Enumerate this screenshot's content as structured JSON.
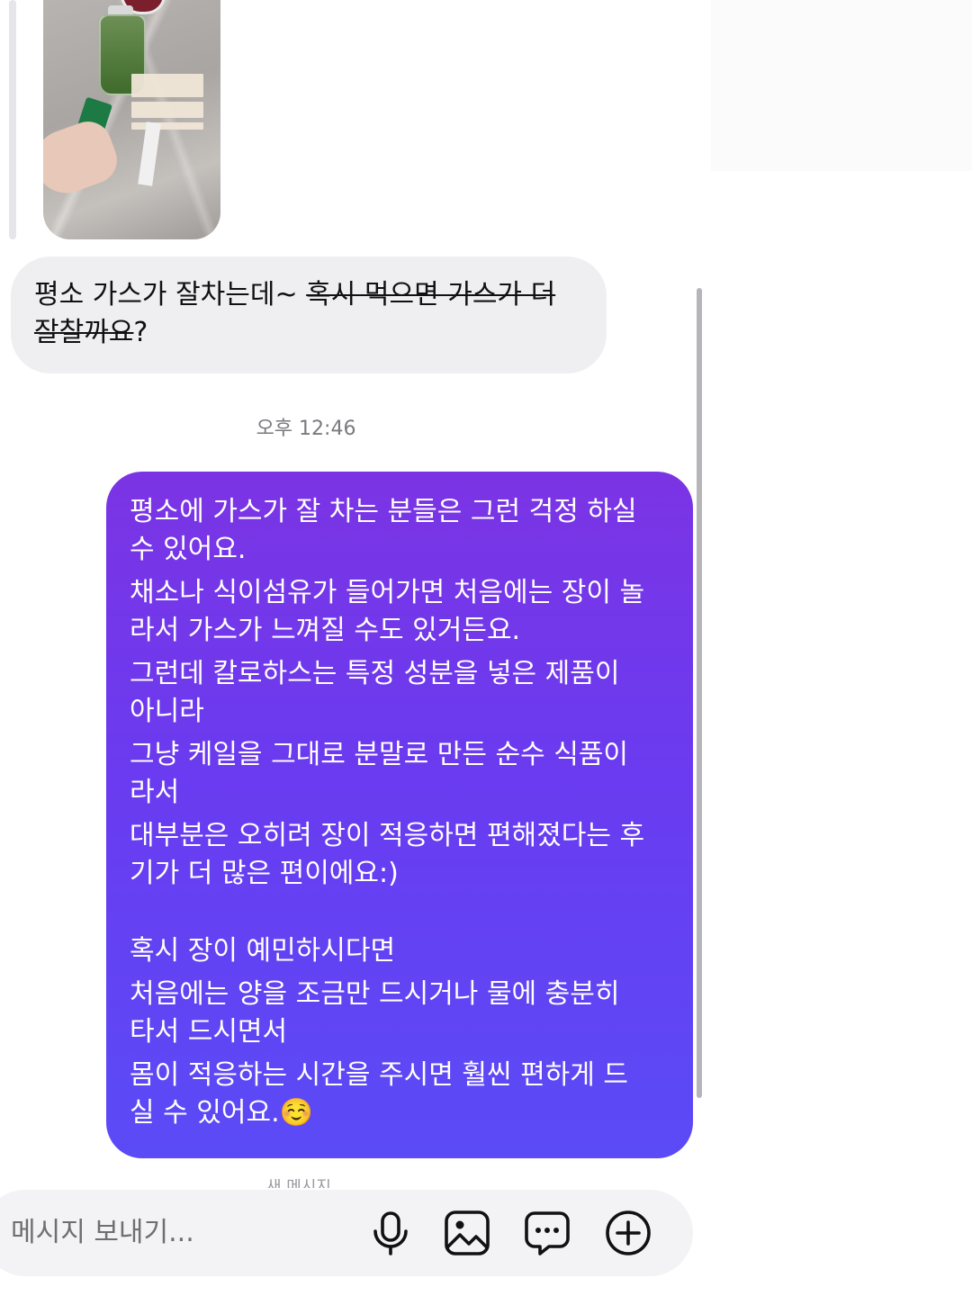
{
  "conversation": {
    "received_message": {
      "plain": "평소 가스가 잘차는데~",
      "strikethrough_line1": "혹시 먹으면 가스가 더",
      "strikethrough_line2": "잘찰까요",
      "ending": "?"
    },
    "timestamp": "오후 12:46",
    "sent_message": {
      "lines": [
        "평소에 가스가 잘 차는 분들은 그런 걱정 하실",
        "수 있어요.",
        "채소나 식이섬유가 들어가면 처음에는 장이 놀",
        "라서 가스가 느껴질 수도 있거든요.",
        "그런데 칼로하스는 특정 성분을 넣은 제품이",
        "아니라",
        "그냥 케일을 그대로 분말로 만든 순수 식품이",
        "라서",
        "대부분은 오히려 장이 적응하면 편해졌다는 후",
        "기가 더 많은 편이에요:)",
        "혹시 장이 예민하시다면",
        "처음에는 양을 조금만 드시거나 물에 충분히",
        "타서 드시면서",
        "몸이 적응하는 시간을 주시면 훨씬 편하게 드",
        "실 수 있어요."
      ],
      "emoji": "☺️"
    },
    "peek_label": "새 메시지"
  },
  "composer": {
    "placeholder": "메시지 보내기...",
    "icons": [
      "microphone-icon",
      "image-icon",
      "sticker-chat-icon",
      "add-circle-icon"
    ]
  },
  "colors": {
    "sent_bubble_top": "#7b34e4",
    "sent_bubble_bottom": "#5a4bf6",
    "received_bubble": "#efeff1",
    "composer_bg": "#f3f3f5"
  }
}
